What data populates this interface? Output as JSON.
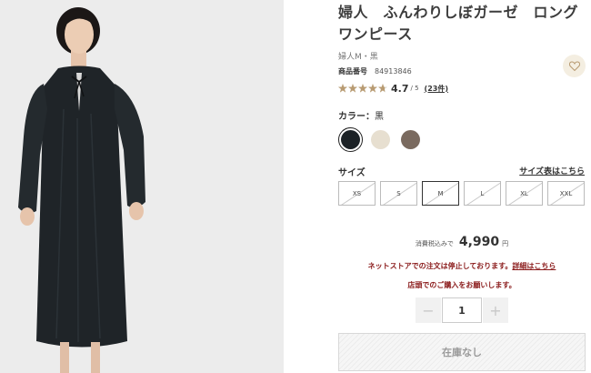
{
  "product": {
    "title": "婦人　ふんわりしぼガーゼ　ロングワンピース",
    "variant": "婦人M・黒",
    "sku_label": "商品番号",
    "sku": "84913846",
    "favorite_icon": "heart-icon"
  },
  "rating": {
    "value": "4.7",
    "value_number": 4.7,
    "max": "/ 5",
    "reviews": "(23件)"
  },
  "color": {
    "label": "カラー：",
    "selected": "黒",
    "options": [
      {
        "name": "黒",
        "hex": "#1c2226"
      },
      {
        "name": "beige",
        "hex": "#e7dfd0"
      },
      {
        "name": "brown",
        "hex": "#7a6a5f"
      }
    ]
  },
  "size": {
    "label": "サイズ",
    "guide": "サイズ表はこちら",
    "options": [
      "XS",
      "S",
      "M",
      "L",
      "XL",
      "XXL"
    ],
    "selected": "M"
  },
  "price": {
    "tax_note": "消費税込みで",
    "amount": "4,990",
    "currency": "円"
  },
  "notices": {
    "line1": "ネットストアでの注文は停止しております。",
    "line1_link": "詳細はこちら",
    "line2": "店頭でのご購入をお願いします。"
  },
  "quantity": {
    "value": "1",
    "minus": "−",
    "plus": "+"
  },
  "stock_button": "在庫なし",
  "colors": {
    "notice": "#8a1a1a",
    "star": "#b89b72",
    "favorite_bg": "#f4eee1"
  }
}
